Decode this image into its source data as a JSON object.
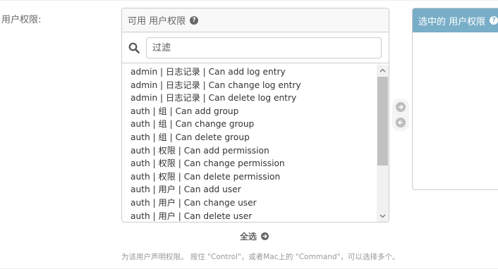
{
  "field": {
    "label": "用户权限:"
  },
  "available": {
    "title": "可用 用户权限",
    "help_icon": "?",
    "filter_placeholder": "过滤",
    "items": [
      "admin | 日志记录 | Can add log entry",
      "admin | 日志记录 | Can change log entry",
      "admin | 日志记录 | Can delete log entry",
      "auth | 组 | Can add group",
      "auth | 组 | Can change group",
      "auth | 组 | Can delete group",
      "auth | 权限 | Can add permission",
      "auth | 权限 | Can change permission",
      "auth | 权限 | Can delete permission",
      "auth | 用户 | Can add user",
      "auth | 用户 | Can change user",
      "auth | 用户 | Can delete user"
    ],
    "choose_all_label": "全选"
  },
  "chosen": {
    "title": "选中的 用户权限",
    "help_icon": "?"
  },
  "help_text": "为该用户声明权限。 按住 \"Control\"，或者Mac上的 \"Command\"，可以选择多个。",
  "colors": {
    "chosen_header_bg": "#79aec8",
    "border": "#cccccc",
    "muted_text": "#666666"
  },
  "icons": {
    "search": "search-icon",
    "add": "arrow-right-circle-icon",
    "remove": "arrow-left-circle-icon",
    "choose_all": "arrow-right-circle-icon",
    "help": "question-circle-icon"
  }
}
